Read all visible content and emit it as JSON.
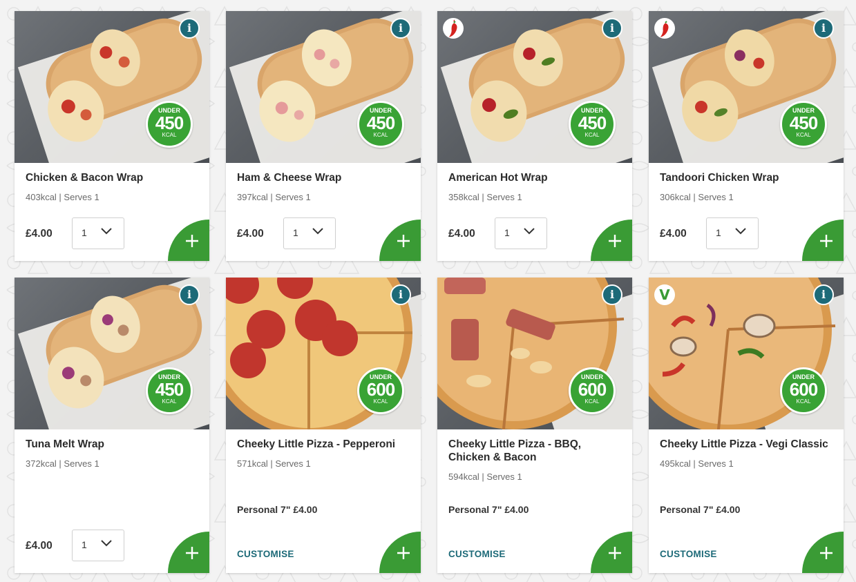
{
  "colors": {
    "accent_green": "#3a9b35",
    "info_teal": "#1d6a78"
  },
  "products": [
    {
      "name": "Chicken & Bacon Wrap",
      "kcal": "403kcal",
      "serves": "Serves 1",
      "price": "£4.00",
      "qty": "1",
      "badge": {
        "top": "UNDER",
        "num": "450",
        "bottom": "KCAL"
      },
      "tag": null,
      "icon": "wrap-image"
    },
    {
      "name": "Ham & Cheese Wrap",
      "kcal": "397kcal",
      "serves": "Serves 1",
      "price": "£4.00",
      "qty": "1",
      "badge": {
        "top": "UNDER",
        "num": "450",
        "bottom": "KCAL"
      },
      "tag": null,
      "icon": "wrap-image"
    },
    {
      "name": "American Hot Wrap",
      "kcal": "358kcal",
      "serves": "Serves 1",
      "price": "£4.00",
      "qty": "1",
      "badge": {
        "top": "UNDER",
        "num": "450",
        "bottom": "KCAL"
      },
      "tag": "chilli-icon",
      "icon": "wrap-image"
    },
    {
      "name": "Tandoori Chicken Wrap",
      "kcal": "306kcal",
      "serves": "Serves 1",
      "price": "£4.00",
      "qty": "1",
      "badge": {
        "top": "UNDER",
        "num": "450",
        "bottom": "KCAL"
      },
      "tag": "chilli-icon",
      "icon": "wrap-image"
    },
    {
      "name": "Tuna Melt Wrap",
      "kcal": "372kcal",
      "serves": "Serves 1",
      "price": "£4.00",
      "qty": "1",
      "badge": {
        "top": "UNDER",
        "num": "450",
        "bottom": "KCAL"
      },
      "tag": null,
      "icon": "wrap-image"
    },
    {
      "name": "Cheeky Little Pizza - Pepperoni",
      "kcal": "571kcal",
      "serves": "Serves 1",
      "personal": "Personal 7\" £4.00",
      "customise": "CUSTOMISE",
      "badge": {
        "top": "UNDER",
        "num": "600",
        "bottom": "KCAL"
      },
      "tag": null,
      "icon": "pizza-image"
    },
    {
      "name": "Cheeky Little Pizza - BBQ, Chicken & Bacon",
      "kcal": "594kcal",
      "serves": "Serves 1",
      "personal": "Personal 7\" £4.00",
      "customise": "CUSTOMISE",
      "badge": {
        "top": "UNDER",
        "num": "600",
        "bottom": "KCAL"
      },
      "tag": null,
      "icon": "pizza-image"
    },
    {
      "name": "Cheeky Little Pizza - Vegi Classic",
      "kcal": "495kcal",
      "serves": "Serves 1",
      "personal": "Personal 7\" £4.00",
      "customise": "CUSTOMISE",
      "badge": {
        "top": "UNDER",
        "num": "600",
        "bottom": "KCAL"
      },
      "tag": "vegetarian-icon",
      "tag_text": "V",
      "icon": "pizza-image"
    }
  ],
  "common": {
    "separator": " | ",
    "info": "i",
    "add": "+"
  }
}
